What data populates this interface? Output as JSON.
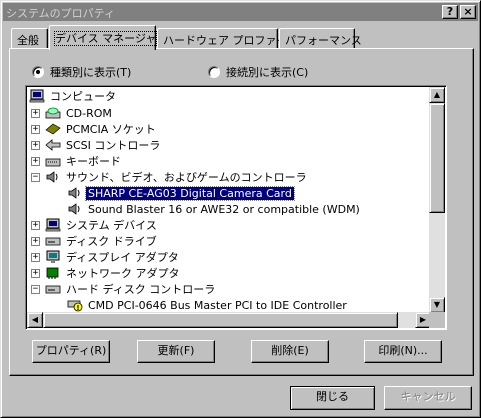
{
  "window": {
    "title": "システムのプロパティ",
    "help_button": "?",
    "close_button": "×"
  },
  "tabs": [
    {
      "label": "全般"
    },
    {
      "label": "デバイス マネージャ"
    },
    {
      "label": "ハードウェア プロファイル"
    },
    {
      "label": "パフォーマンス"
    }
  ],
  "view_options": {
    "by_type": "種類別に表示(T)",
    "by_connection": "接続別に表示(C)",
    "selected": "by_type"
  },
  "tree": {
    "root": "コンピュータ",
    "items": [
      {
        "label": "CD-ROM",
        "icon": "cdrom-icon",
        "expander": "+"
      },
      {
        "label": "PCMCIA ソケット",
        "icon": "pcmcia-icon",
        "expander": "+"
      },
      {
        "label": "SCSI コントローラ",
        "icon": "scsi-icon",
        "expander": "+"
      },
      {
        "label": "キーボード",
        "icon": "keyboard-icon",
        "expander": "+"
      },
      {
        "label": "サウンド、ビデオ、およびゲームのコントローラ",
        "icon": "sound-icon",
        "expander": "−",
        "children": [
          {
            "label": "SHARP CE-AG03 Digital Camera Card",
            "icon": "sound-device-icon",
            "selected": true
          },
          {
            "label": "Sound Blaster 16 or AWE32 or compatible (WDM)",
            "icon": "sound-device-icon",
            "selected": false
          }
        ]
      },
      {
        "label": "システム デバイス",
        "icon": "system-device-icon",
        "expander": "+"
      },
      {
        "label": "ディスク ドライブ",
        "icon": "disk-drive-icon",
        "expander": "+"
      },
      {
        "label": "ディスプレイ アダプタ",
        "icon": "display-adapter-icon",
        "expander": "+"
      },
      {
        "label": "ネットワーク アダプタ",
        "icon": "network-adapter-icon",
        "expander": "+"
      },
      {
        "label": "ハード ディスク コントローラ",
        "icon": "hdd-controller-icon",
        "expander": "−",
        "children": [
          {
            "label": "CMD PCI-0646 Bus Master PCI to IDE Controller",
            "icon": "warning-icon",
            "selected": false
          }
        ]
      }
    ]
  },
  "buttons": {
    "properties": "プロパティ(R)",
    "refresh": "更新(F)",
    "remove": "削除(E)",
    "print": "印刷(N)...",
    "close": "閉じる",
    "cancel": "キャンセル"
  },
  "colors": {
    "selection": "#000080",
    "face": "#c0c0c0"
  }
}
